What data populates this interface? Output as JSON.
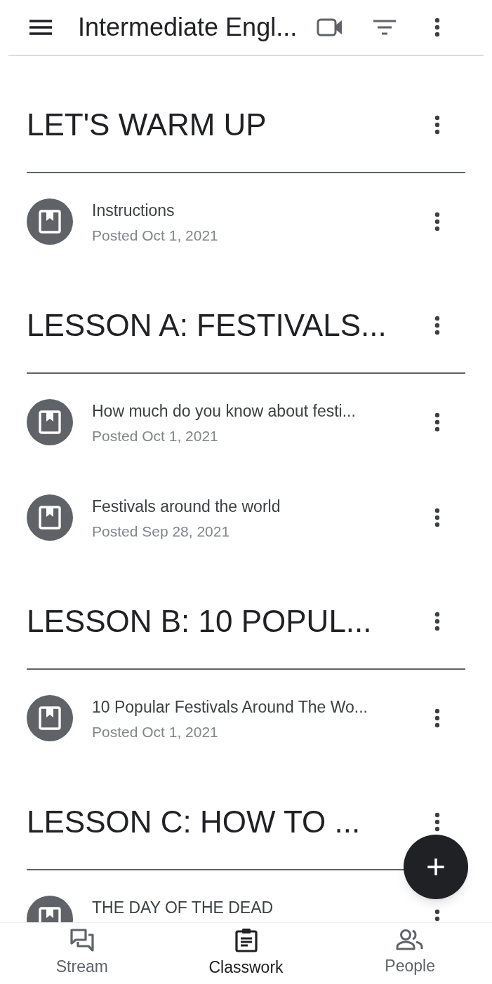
{
  "app_bar": {
    "title": "Intermediate Engl..."
  },
  "topics": [
    {
      "title": "LET'S WARM UP",
      "items": [
        {
          "title": "Instructions",
          "posted": "Posted Oct 1, 2021"
        }
      ]
    },
    {
      "title": "LESSON A: FESTIVALS...",
      "items": [
        {
          "title": "How much do you know about festi...",
          "posted": "Posted Oct 1, 2021"
        },
        {
          "title": "Festivals around the world",
          "posted": "Posted Sep 28, 2021"
        }
      ]
    },
    {
      "title": "LESSON B: 10 POPUL...",
      "items": [
        {
          "title": "10 Popular Festivals Around The Wo...",
          "posted": "Posted Oct 1, 2021"
        }
      ]
    },
    {
      "title": "LESSON C: HOW TO ...",
      "items": [
        {
          "title": "THE DAY OF THE DEAD"
        }
      ]
    }
  ],
  "fab": {
    "label": "+"
  },
  "bottom_nav": [
    {
      "label": "Stream",
      "kind": "stream",
      "selected": false
    },
    {
      "label": "Classwork",
      "kind": "classwork",
      "selected": true
    },
    {
      "label": "People",
      "kind": "people",
      "selected": false
    }
  ]
}
